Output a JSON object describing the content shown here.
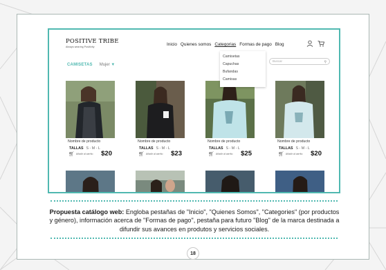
{
  "logo": {
    "name": "POSITIVE TRIBE",
    "tagline": "Always wearing Positivity"
  },
  "nav": {
    "items": [
      "Inicio",
      "Quienes somos",
      "Categorias",
      "Formas de pago",
      "Blog"
    ],
    "active": "Categorias"
  },
  "header_icons": [
    "user-icon",
    "cart-icon"
  ],
  "dropdown": {
    "items": [
      "Camisetas",
      "Capuchas",
      "Bufandas",
      "Camisas"
    ]
  },
  "filter": {
    "category": "CAMISETAS",
    "subcategory": "Mujer"
  },
  "search": {
    "placeholder": "Buscar"
  },
  "products": [
    {
      "name": "Nombre de producto",
      "sizes_label": "TALLAS",
      "sizes": "S - M - L",
      "buy_label": "Añadir al carrito",
      "price": "$20"
    },
    {
      "name": "Nombre de producto",
      "sizes_label": "TALLAS",
      "sizes": "S - M - L",
      "buy_label": "Añadir al carrito",
      "price": "$23"
    },
    {
      "name": "Nombre de producto",
      "sizes_label": "TALLAS",
      "sizes": "S - M - L",
      "buy_label": "Añadir al carrito",
      "price": "$25"
    },
    {
      "name": "Nombre de producto",
      "sizes_label": "TALLAS",
      "sizes": "S - M - L",
      "buy_label": "Añadir al carrito",
      "price": "$20"
    }
  ],
  "caption": {
    "lead": "Propuesta catálogo web:",
    "body": " Engloba pestañas de \"Inicio\", \"Quienes Somos\", \"Categories\" (por productos y género), información acerca de \"Formas de pago\", pestaña para futuro \"Blog\" de la marca destinada a difundir sus avances en produtos y servicios sociales."
  },
  "page_number": "18",
  "colors": {
    "accent": "#4fb8b0",
    "frame": "#aab7b4"
  }
}
